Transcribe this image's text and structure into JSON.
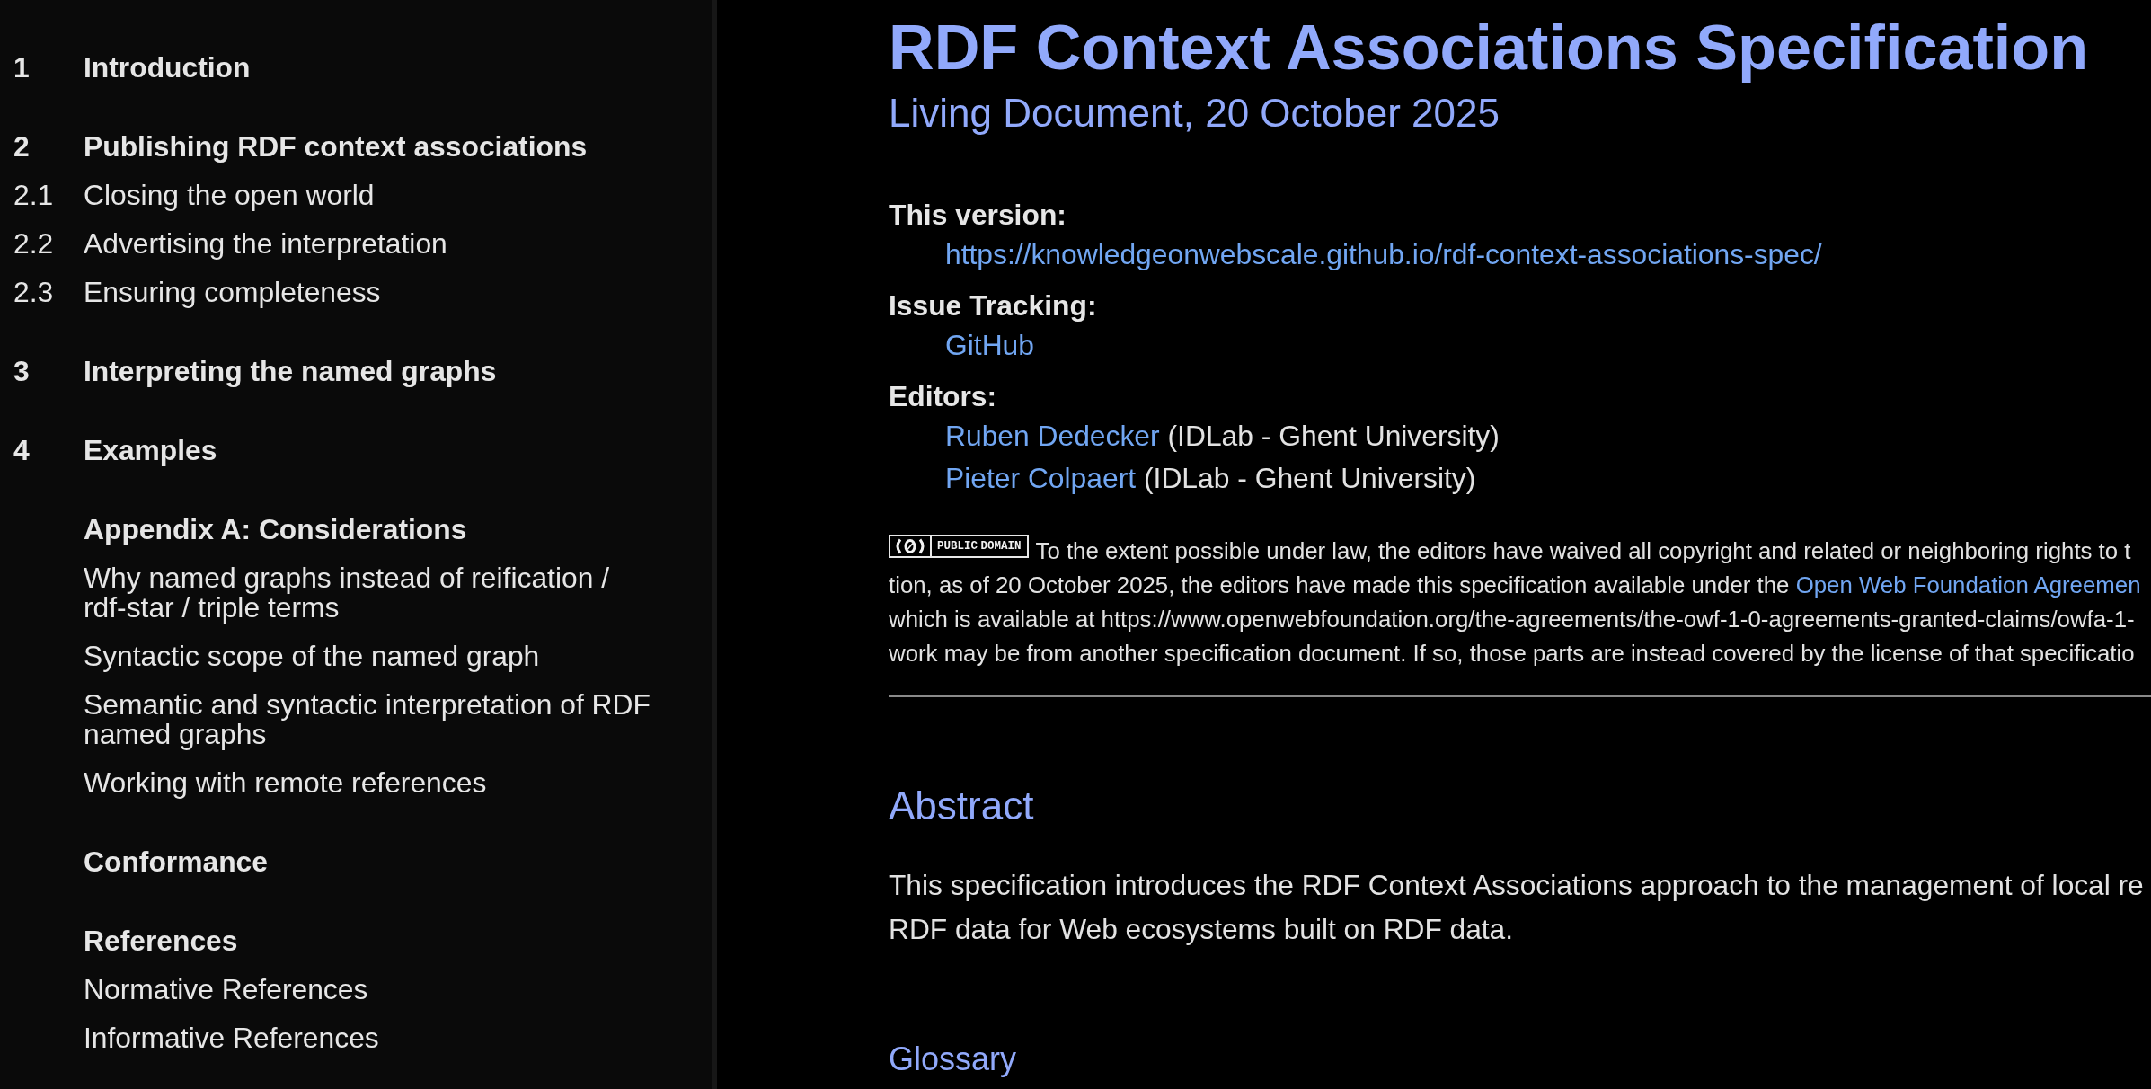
{
  "toc": {
    "items": [
      {
        "number": "1",
        "title": "Introduction"
      },
      {
        "number": "2",
        "title": "Publishing RDF context associations",
        "children": [
          {
            "number": "2.1",
            "title": "Closing the open world"
          },
          {
            "number": "2.2",
            "title": "Advertising the interpretation"
          },
          {
            "number": "2.3",
            "title": "Ensuring completeness"
          }
        ]
      },
      {
        "number": "3",
        "title": "Interpreting the named graphs"
      },
      {
        "number": "4",
        "title": "Examples"
      },
      {
        "title": "Appendix A: Considerations",
        "children": [
          {
            "title": "Why named graphs instead of reification / rdf-star / triple terms"
          },
          {
            "title": "Syntactic scope of the named graph"
          },
          {
            "title": "Semantic and syntactic interpretation of RDF named graphs"
          },
          {
            "title": "Working with remote references"
          }
        ]
      },
      {
        "title": "Conformance"
      },
      {
        "title": "References",
        "children": [
          {
            "title": "Normative References"
          },
          {
            "title": "Informative References"
          }
        ]
      }
    ]
  },
  "header": {
    "title": "RDF Context Associations Specification",
    "subtitle": "Living Document, 20 October 2025",
    "metadata": [
      {
        "label": "This version:",
        "values": [
          [
            {
              "kind": "link",
              "text": "https://knowledgeonwebscale.github.io/rdf-context-associations-spec/"
            }
          ]
        ]
      },
      {
        "label": "Issue Tracking:",
        "values": [
          [
            {
              "kind": "link",
              "text": "GitHub"
            }
          ]
        ]
      },
      {
        "label": "Editors:",
        "values": [
          [
            {
              "kind": "link",
              "text": "Ruben Dedecker"
            },
            {
              "kind": "text",
              "text": "(IDLab - Ghent University)"
            }
          ],
          [
            {
              "kind": "link",
              "text": "Pieter Colpaert"
            },
            {
              "kind": "text",
              "text": "(IDLab - Ghent University)"
            }
          ]
        ]
      }
    ]
  },
  "copyright": {
    "lines": [
      [
        {
          "kind": "badge",
          "text": "PUBLIC DOMAIN"
        },
        {
          "kind": "text",
          "text": "To the extent possible under law, the editors have waived all copyright and related or neighboring rights to t"
        }
      ],
      [
        {
          "kind": "text",
          "text": "tion, as of 20 October 2025, the editors have made this specification available under the"
        },
        {
          "kind": "link",
          "text": "Open Web Foundation Agreemen"
        }
      ],
      [
        {
          "kind": "text",
          "text": "which is available at https://www.openwebfoundation.org/the-agreements/the-owf-1-0-agreements-granted-claims/owfa-1-"
        }
      ],
      [
        {
          "kind": "text",
          "text": "work may be from another specification document. If so, those parts are instead covered by the license of that specificatio"
        }
      ]
    ]
  },
  "sections": [
    {
      "kind": "h2",
      "heading": "Abstract",
      "lines": [
        "This specification introduces the RDF Context Associations approach to the management of local re",
        "RDF data for Web ecosystems built on RDF data."
      ]
    },
    {
      "kind": "h3",
      "heading": "Glossary"
    }
  ]
}
